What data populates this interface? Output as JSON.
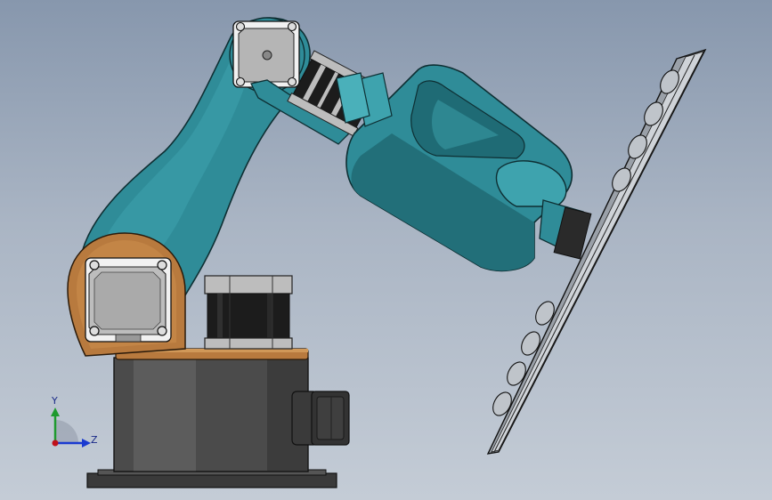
{
  "triad": {
    "y_label": "Y",
    "z_label": "Z"
  },
  "colors": {
    "background_top": "#8797ad",
    "background_bottom": "#c4ccd6",
    "arm_teal": "#2f8c98",
    "arm_teal_light": "#3ea3ae",
    "arm_teal_dark": "#1f6b75",
    "bronze": "#b87a3e",
    "base_gray": "#4e4e4e",
    "motor_black": "#1c1c1c",
    "motor_silver": "#b8b8b8",
    "axis_y": "#1e9a2e",
    "axis_z": "#1a3ad0",
    "axis_x": "#c0101a"
  }
}
